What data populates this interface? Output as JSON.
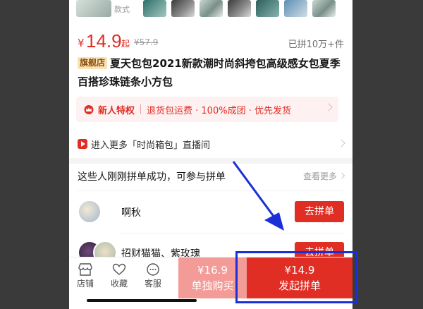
{
  "gallery": {
    "more_label_line1": "",
    "more_label_line2": "款式"
  },
  "product": {
    "currency": "¥",
    "price": "14.9",
    "price_suffix": "起",
    "original_price": "¥57.9",
    "sold_count": "已拼10万+件",
    "store_badge": "旗舰店",
    "title": "夏天包包2021新款潮时尚斜挎包高级感女包夏季百搭珍珠链条小方包"
  },
  "promo": {
    "label": "新人特权",
    "details": "退货包运费 · 100%成团 · 优先发货"
  },
  "live_room": {
    "text": "进入更多「时尚箱包」直播间"
  },
  "group_buy": {
    "heading": "这些人刚刚拼单成功，可参与拼单",
    "see_more": "查看更多",
    "members": [
      {
        "name": "啊秋",
        "button": "去拼单"
      },
      {
        "name": "招财猫猫、紫玫瑰",
        "button": "去拼单"
      }
    ]
  },
  "bottom_bar": {
    "tabs": [
      {
        "label": "店铺",
        "icon": "store-icon"
      },
      {
        "label": "收藏",
        "icon": "heart-icon"
      },
      {
        "label": "客服",
        "icon": "chat-icon"
      }
    ],
    "single_buy": {
      "price": "¥16.9",
      "label": "单独购买"
    },
    "group_buy": {
      "price": "¥14.9",
      "label": "发起拼单"
    }
  },
  "colors": {
    "accent": "#e02e24",
    "single_buy_bg": "#f29b97",
    "annotation": "#1a2fd8"
  }
}
